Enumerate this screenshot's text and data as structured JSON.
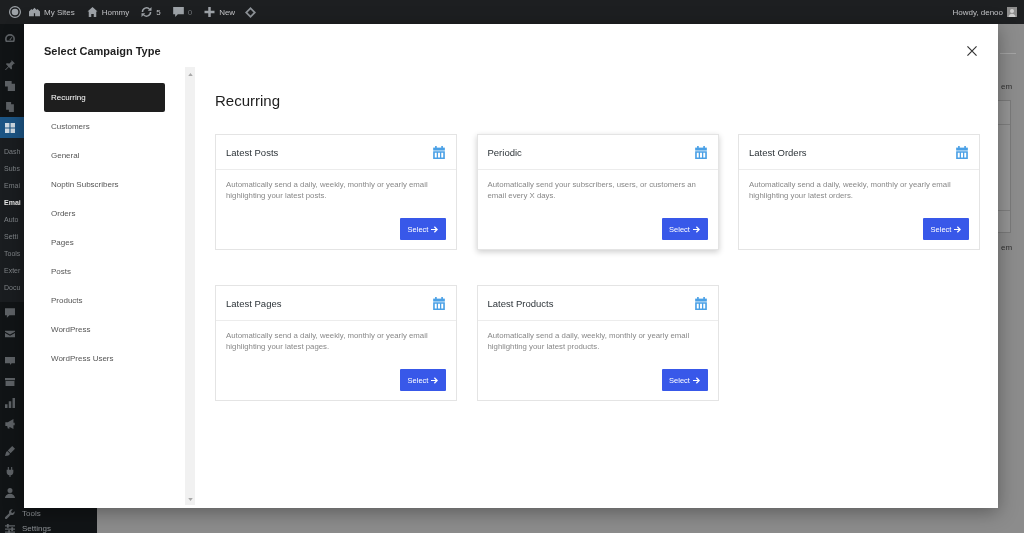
{
  "admin_bar": {
    "items": [
      {
        "label": "My Sites",
        "dimmed": false
      },
      {
        "label": "Hommy",
        "dimmed": false
      },
      {
        "label": "5",
        "dimmed": false
      },
      {
        "label": "0",
        "dimmed": true
      },
      {
        "label": "New",
        "dimmed": false
      }
    ],
    "greeting": "Howdy, denoo"
  },
  "admin_menu": {
    "groups": [
      [
        {
          "selected": false
        }
      ],
      [
        {
          "selected": false
        },
        {
          "selected": false
        },
        {
          "selected": false
        },
        {
          "selected": true,
          "submenu": [
            {
              "label": "Dash",
              "selected": false
            },
            {
              "label": "Subs",
              "selected": false
            },
            {
              "label": "Emai",
              "selected": false
            },
            {
              "label": "Emai",
              "selected": true
            },
            {
              "label": "Auto",
              "selected": false
            },
            {
              "label": "Setti",
              "selected": false
            },
            {
              "label": "Tools",
              "selected": false
            },
            {
              "label": "Exter",
              "selected": false
            },
            {
              "label": "Docu",
              "selected": false
            }
          ]
        },
        {
          "selected": false
        },
        {
          "selected": false
        }
      ],
      [
        {
          "selected": false
        },
        {
          "selected": false
        },
        {
          "selected": false
        },
        {
          "selected": false
        }
      ],
      [
        {
          "selected": false
        },
        {
          "selected": false
        },
        {
          "selected": false
        },
        {
          "label": "Tools",
          "selected": false
        },
        {
          "label": "Settings",
          "selected": false
        }
      ]
    ]
  },
  "page_background": {
    "labels": [
      "em",
      "em"
    ]
  },
  "modal": {
    "title": "Select Campaign Type",
    "nav": [
      {
        "label": "Recurring",
        "selected": true
      },
      {
        "label": "Customers",
        "selected": false
      },
      {
        "label": "General",
        "selected": false
      },
      {
        "label": "Noptin Subscribers",
        "selected": false
      },
      {
        "label": "Orders",
        "selected": false
      },
      {
        "label": "Pages",
        "selected": false
      },
      {
        "label": "Posts",
        "selected": false
      },
      {
        "label": "Products",
        "selected": false
      },
      {
        "label": "WordPress",
        "selected": false
      },
      {
        "label": "WordPress Users",
        "selected": false
      }
    ],
    "heading": "Recurring",
    "cards": [
      {
        "title": "Latest Posts",
        "description": "Automatically send a daily, weekly, monthly or yearly email highlighting your latest posts.",
        "button": "Select",
        "hovered": false
      },
      {
        "title": "Periodic",
        "description": "Automatically send your subscribers, users, or customers an email every X days.",
        "button": "Select",
        "hovered": true
      },
      {
        "title": "Latest Orders",
        "description": "Automatically send a daily, weekly, monthly or yearly email highlighting your latest orders.",
        "button": "Select",
        "hovered": false
      },
      {
        "title": "Latest Pages",
        "description": "Automatically send a daily, weekly, monthly or yearly email highlighting your latest pages.",
        "button": "Select",
        "hovered": false
      },
      {
        "title": "Latest Products",
        "description": "Automatically send a daily, weekly, monthly or yearly email highlighting your latest products.",
        "button": "Select",
        "hovered": false
      }
    ]
  }
}
